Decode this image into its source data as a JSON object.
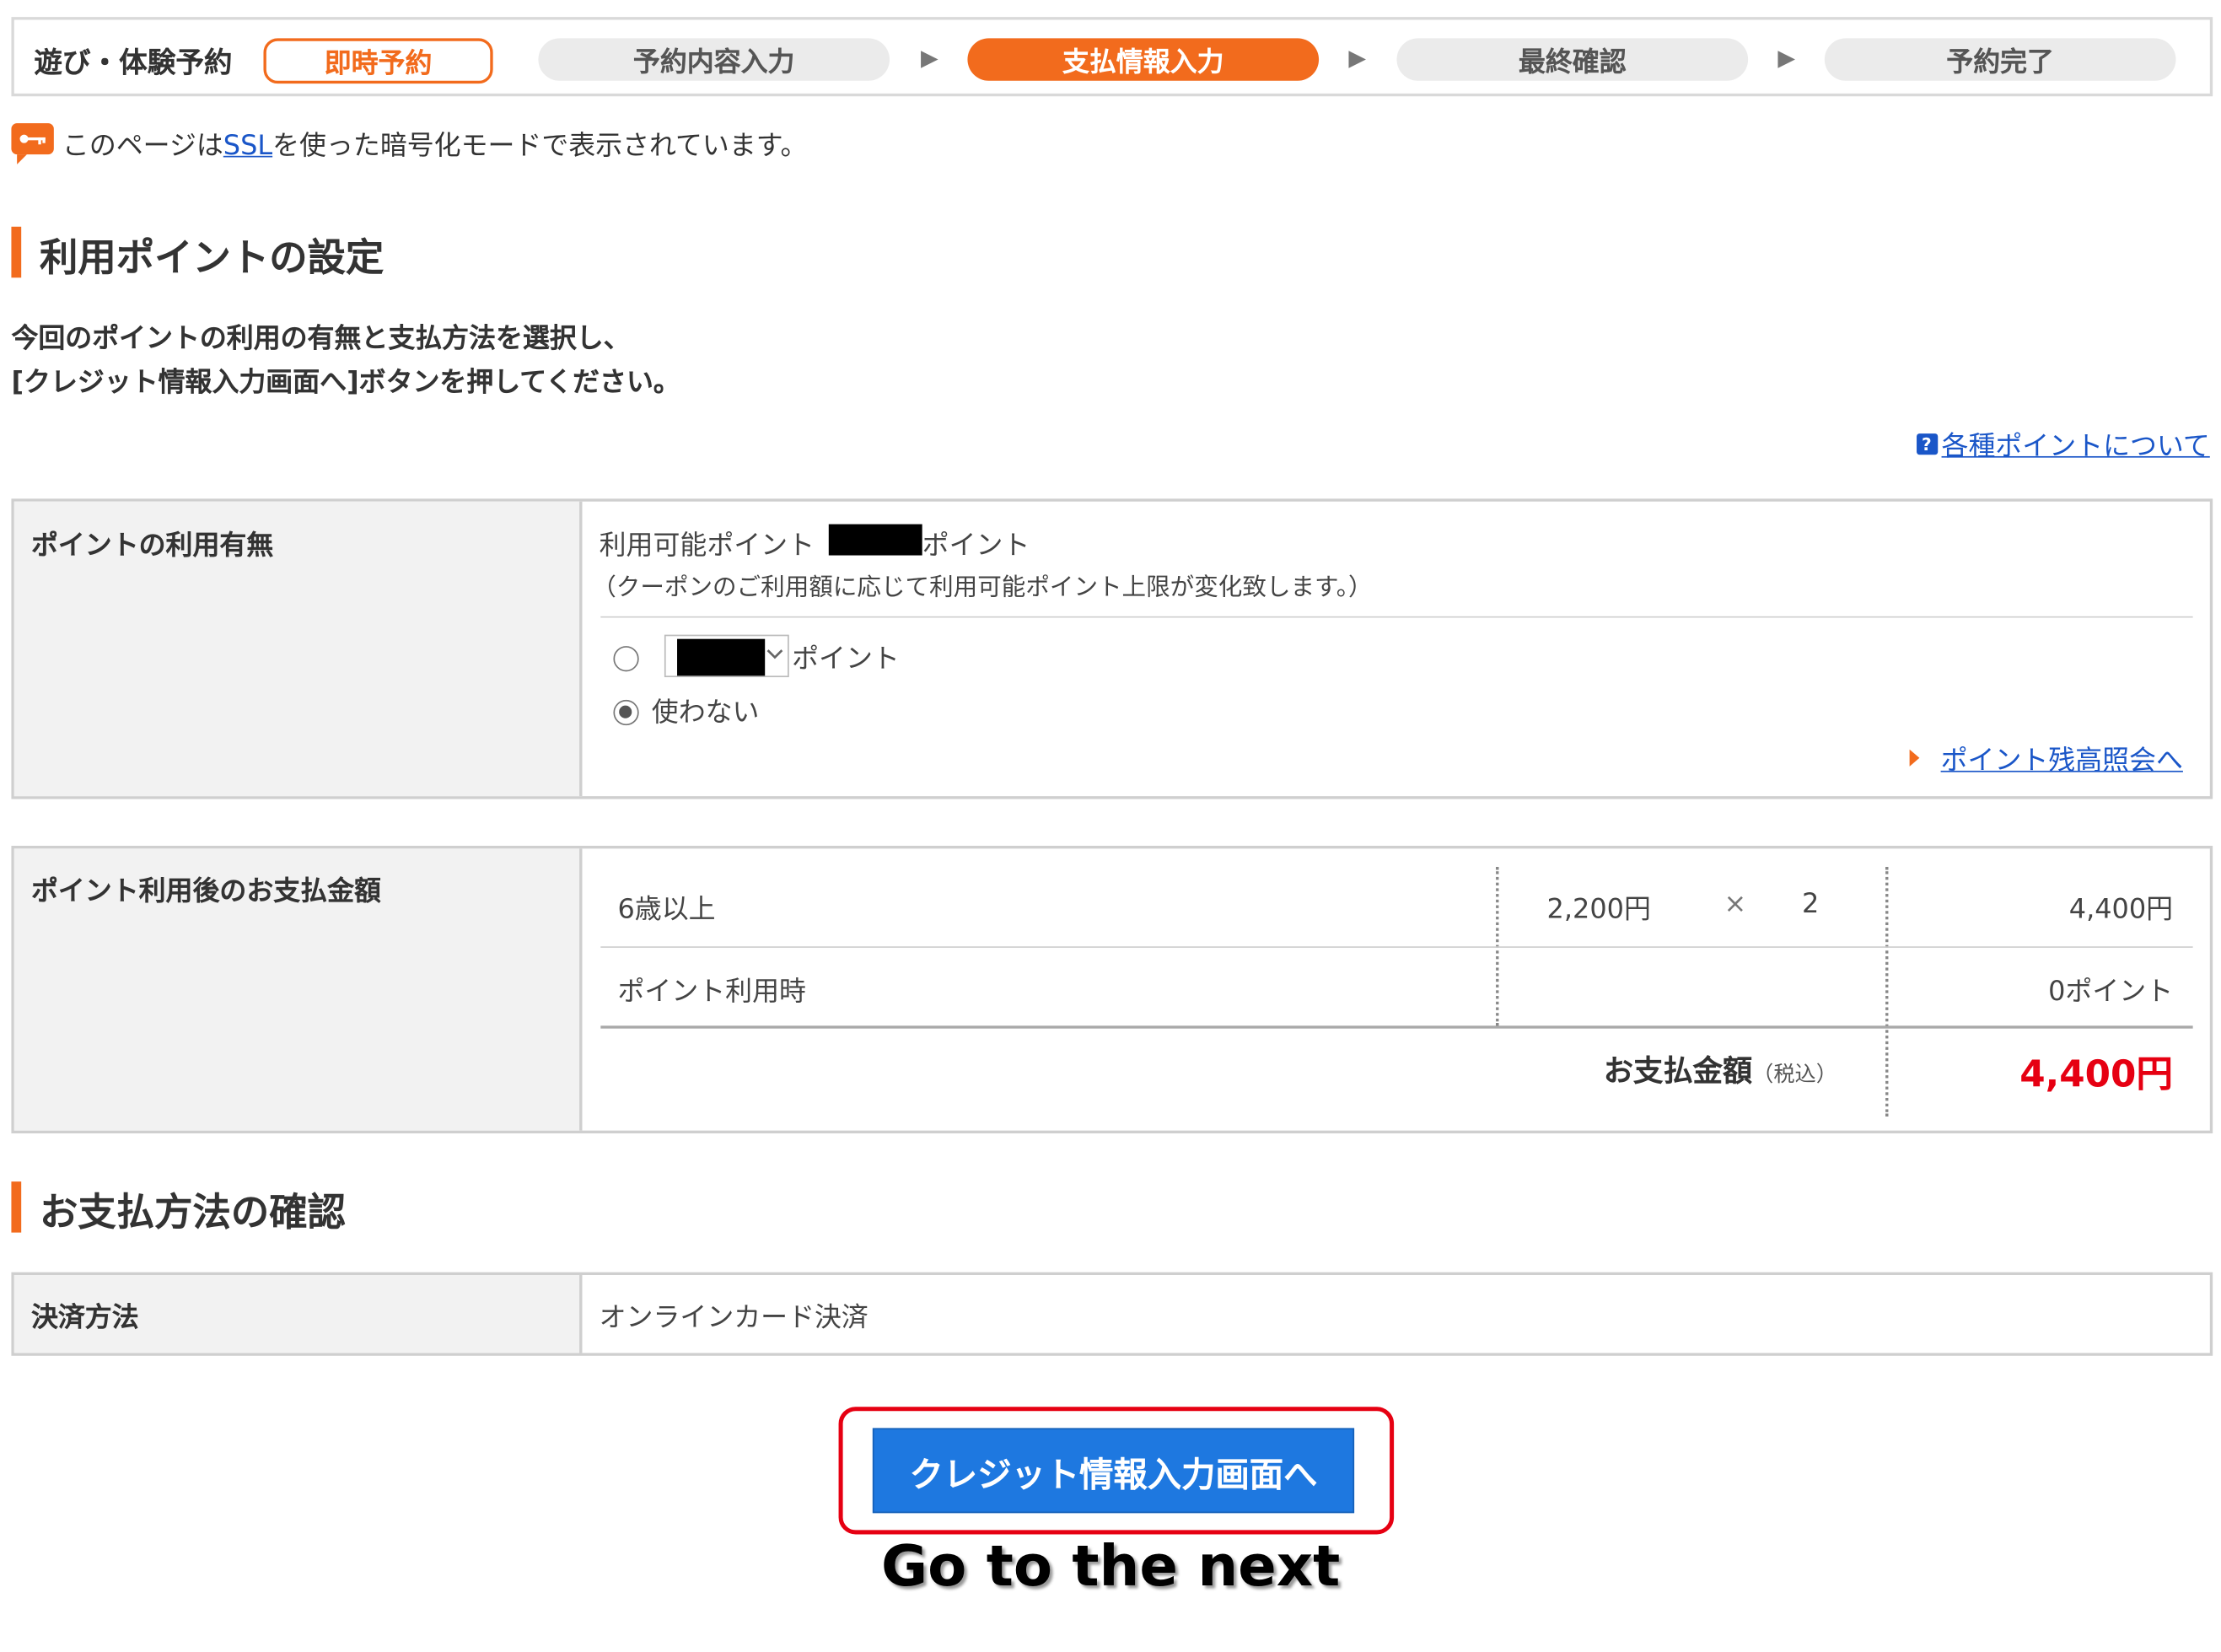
{
  "stepbar": {
    "label": "遊び・体験予約",
    "badge": "即時予約",
    "steps": [
      "予約内容入力",
      "支払情報入力",
      "最終確認",
      "予約完了"
    ],
    "arrow": "▶",
    "active_step": "支払情報入力"
  },
  "ssl_notice": {
    "prefix": "このページは",
    "link": "SSL",
    "suffix": "を使った暗号化モードで表示されています。"
  },
  "points_section": {
    "heading": "利用ポイントの設定",
    "instruction_line1": "今回のポイントの利用の有無と支払方法を選択し、",
    "instruction_line2": "[クレジット情報入力画面へ]ボタンを押してください。",
    "help_link": "各種ポイントについて",
    "help_icon": "?",
    "usage_row": {
      "label": "ポイントの利用有無",
      "available_prefix": "利用可能ポイント",
      "available_suffix": "ポイント",
      "note": "（クーポンのご利用額に応じて利用可能ポイント上限が変化致します。）",
      "use_option_suffix": "ポイント",
      "no_use_option": "使わない",
      "selected_option": "使わない",
      "balance_link": "ポイント残高照会へ"
    },
    "payment_row": {
      "label": "ポイント利用後のお支払金額",
      "item_name": "6歳以上",
      "unit_price": "2,200円",
      "times": "×",
      "quantity": "2",
      "subtotal": "4,400円",
      "points_label": "ポイント利用時",
      "points_value": "0ポイント",
      "total_label": "お支払金額",
      "total_tax_note": "（税込）",
      "total_amount": "4,400円"
    }
  },
  "payment_method_section": {
    "heading": "お支払方法の確認",
    "row_label": "決済方法",
    "row_value": "オンラインカード決済"
  },
  "cta": {
    "button_label": "クレジット情報入力画面へ",
    "caption": "Go to the next"
  },
  "colors": {
    "accent_orange": "#f26b1d",
    "link_blue": "#1a56c8",
    "button_blue": "#1e78e0",
    "total_red": "#e60012"
  }
}
